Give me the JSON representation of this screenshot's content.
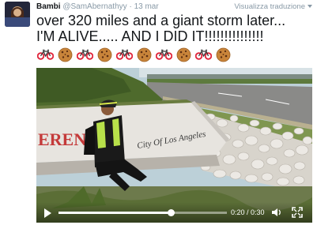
{
  "tweet": {
    "author_name": "Bambi",
    "handle": "@SamAbernathyy",
    "separator": "·",
    "date": "13 mar",
    "translate_label": "Visualizza traduzione",
    "text_line1": "over 320 miles and a giant storm later...",
    "text_line2": "I'M ALIVE..... AND I DID IT!!!!!!!!!!!!!!!",
    "emojis": [
      "bicycle",
      "cookie",
      "bicycle",
      "cookie",
      "bicycle",
      "cookie",
      "bicycle",
      "cookie",
      "bicycle",
      "cookie"
    ]
  },
  "video": {
    "sign_text_left": "ERENC",
    "sign_text_city": "City Of Los Angeles",
    "current_time": "0:20",
    "duration": "0:30",
    "time_display": "0:20 / 0:30",
    "progress": 0.667
  },
  "colors": {
    "text": "#14171a",
    "muted": "#8899a6",
    "bike_red": "#e0243a",
    "cookie": "#c8843a"
  }
}
